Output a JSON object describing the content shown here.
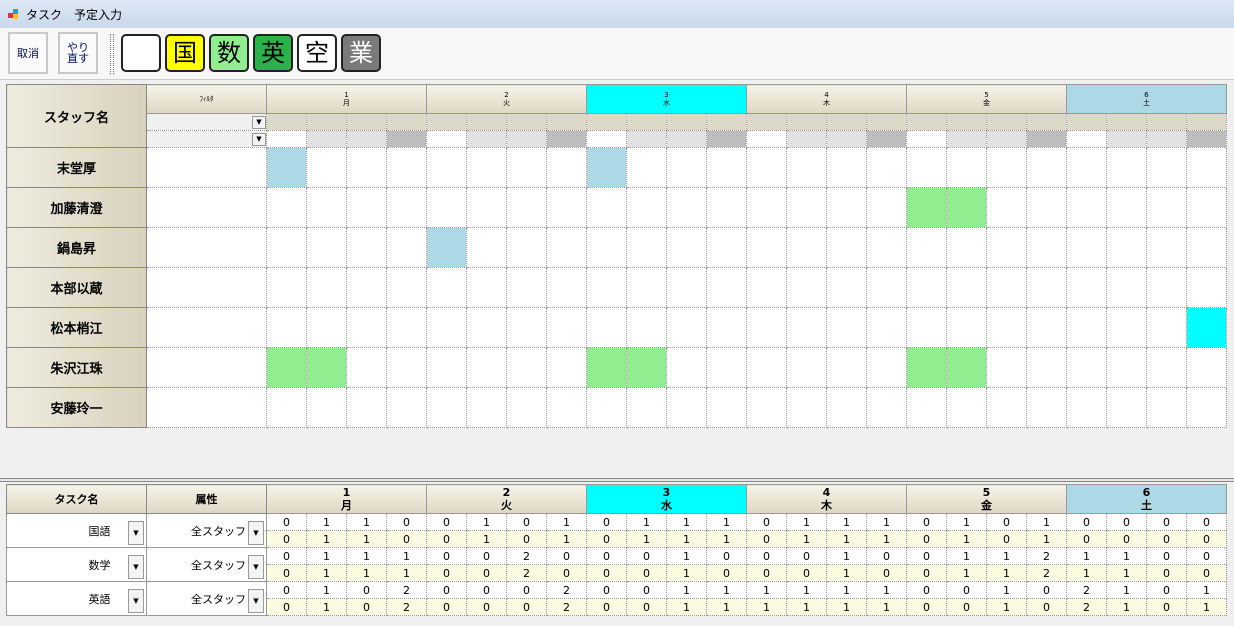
{
  "window": {
    "title": "タスク　予定入力"
  },
  "toolbar": {
    "cancel_label": "取消",
    "redo_label": "やり直す",
    "categories": [
      {
        "label": "",
        "color": "#ffffff",
        "text_color": "#000000"
      },
      {
        "label": "国",
        "color": "#ffff00",
        "text_color": "#000000"
      },
      {
        "label": "数",
        "color": "#90ee90",
        "text_color": "#000000"
      },
      {
        "label": "英",
        "color": "#2db14a",
        "text_color": "#000000"
      },
      {
        "label": "空",
        "color": "#ffffff",
        "text_color": "#000000"
      },
      {
        "label": "業",
        "color": "#7a7a7a",
        "text_color": "#ffffff"
      }
    ]
  },
  "schedule": {
    "staff_header": "スタッフ名",
    "filter_label": "ﾌｨﾙﾀ",
    "days": [
      {
        "num": "1",
        "dow": "月",
        "color": ""
      },
      {
        "num": "2",
        "dow": "火",
        "color": ""
      },
      {
        "num": "3",
        "dow": "水",
        "color": "#00ffff"
      },
      {
        "num": "4",
        "dow": "木",
        "color": ""
      },
      {
        "num": "5",
        "dow": "金",
        "color": ""
      },
      {
        "num": "6",
        "dow": "土",
        "color": "#add8e6"
      }
    ],
    "staff": [
      {
        "name": "末堂厚",
        "cells": {
          "0": "#add8e6",
          "8": "#add8e6"
        }
      },
      {
        "name": "加藤清澄",
        "cells": {
          "16": "#90ee90",
          "17": "#90ee90"
        }
      },
      {
        "name": "鍋島昇",
        "cells": {
          "4": "#add8e6"
        }
      },
      {
        "name": "本部以蔵",
        "cells": {}
      },
      {
        "name": "松本梢江",
        "cells": {
          "23": "#00ffff"
        }
      },
      {
        "name": "朱沢江珠",
        "cells": {
          "0": "#90ee90",
          "1": "#90ee90",
          "8": "#90ee90",
          "9": "#90ee90",
          "16": "#90ee90",
          "17": "#90ee90"
        }
      },
      {
        "name": "安藤玲一",
        "cells": {}
      }
    ]
  },
  "tasks": {
    "task_header": "タスク名",
    "attr_header": "属性",
    "rows": [
      {
        "name": "国語",
        "attr": "全スタッフ",
        "top": [
          "0",
          "1",
          "1",
          "0",
          "0",
          "1",
          "0",
          "1",
          "0",
          "1",
          "1",
          "1",
          "0",
          "1",
          "1",
          "1",
          "0",
          "1",
          "0",
          "1",
          "0",
          "0",
          "0",
          "0"
        ],
        "bottom": [
          "0",
          "1",
          "1",
          "0",
          "0",
          "1",
          "0",
          "1",
          "0",
          "1",
          "1",
          "1",
          "0",
          "1",
          "1",
          "1",
          "0",
          "1",
          "0",
          "1",
          "0",
          "0",
          "0",
          "0"
        ]
      },
      {
        "name": "数学",
        "attr": "全スタッフ",
        "top": [
          "0",
          "1",
          "1",
          "1",
          "0",
          "0",
          "2",
          "0",
          "0",
          "0",
          "1",
          "0",
          "0",
          "0",
          "1",
          "0",
          "0",
          "1",
          "1",
          "2",
          "1",
          "1",
          "0",
          "0"
        ],
        "bottom": [
          "0",
          "1",
          "1",
          "1",
          "0",
          "0",
          "2",
          "0",
          "0",
          "0",
          "1",
          "0",
          "0",
          "0",
          "1",
          "0",
          "0",
          "1",
          "1",
          "2",
          "1",
          "1",
          "0",
          "0"
        ]
      },
      {
        "name": "英語",
        "attr": "全スタッフ",
        "top": [
          "0",
          "1",
          "0",
          "2",
          "0",
          "0",
          "0",
          "2",
          "0",
          "0",
          "1",
          "1",
          "1",
          "1",
          "1",
          "1",
          "0",
          "0",
          "1",
          "0",
          "2",
          "1",
          "0",
          "1"
        ],
        "bottom": [
          "0",
          "1",
          "0",
          "2",
          "0",
          "0",
          "0",
          "2",
          "0",
          "0",
          "1",
          "1",
          "1",
          "1",
          "1",
          "1",
          "0",
          "0",
          "1",
          "0",
          "2",
          "1",
          "0",
          "1"
        ]
      }
    ]
  }
}
